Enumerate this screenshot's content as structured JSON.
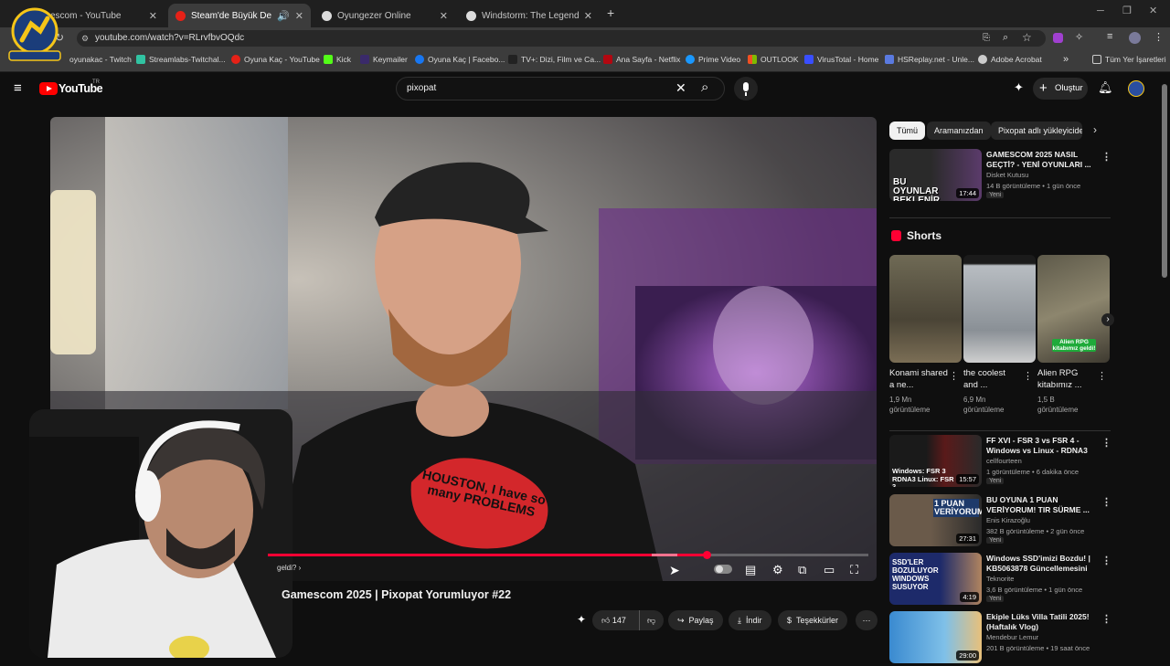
{
  "browser": {
    "tabs": [
      {
        "title": "escom - YouTube",
        "active": false
      },
      {
        "title": "Steam'de Büyük Değişiklik",
        "active": true
      },
      {
        "title": "Oyungezer Online",
        "active": false
      },
      {
        "title": "Windstorm: The Legend of Khi",
        "active": false
      }
    ],
    "url": "youtube.com/watch?v=RLrvfbvOQdc",
    "bookmarks": [
      "oyunakac - Twitch",
      "Streamlabs-Twitchal...",
      "Oyuna Kaç - YouTube",
      "Kick",
      "Keymailer",
      "Oyuna Kaç | Facebo...",
      "TV+: Dizi, Film ve Ca...",
      "Ana Sayfa - Netflix",
      "Prime Video",
      "OUTLOOK",
      "VirusTotal - Home",
      "HSReplay.net - Unle...",
      "Adobe Acrobat"
    ],
    "all_bookmarks": "Tüm Yer İşaretleri"
  },
  "youtube": {
    "logo": "YouTube",
    "country": "TR",
    "search_value": "pixopat",
    "create_label": "Oluştur"
  },
  "video": {
    "title": "Gamescom 2025 | Pixopat Yorumluyor #22",
    "chapter": "geldi?",
    "progress": 0.73,
    "likes": "147",
    "share": "Paylaş",
    "download": "İndir",
    "thanks": "Teşekkürler",
    "shirt_text": "HOUSTON, I have so many PROBLEMS"
  },
  "sidebar": {
    "chips": [
      "Tümü",
      "Aramanızdan",
      "Pixopat adlı yükleyiciden"
    ],
    "shorts_title": "Shorts",
    "shorts": [
      {
        "title": "Konami shared a ne...",
        "views": "1,9 Mn görüntüleme"
      },
      {
        "title": "the coolest and ...",
        "views": "6,9 Mn görüntüleme"
      },
      {
        "title": "Alien RPG kitabımız ...",
        "views": "1,5 B görüntüleme"
      }
    ],
    "recs": [
      {
        "title": "GAMESCOM 2025 NASIL GEÇTİ? - YENİ OYUNLARI ...",
        "channel": "Disket Kutusu",
        "meta": "14 B görüntüleme • 1 gün önce",
        "badge": "Yeni",
        "duration": "17:44"
      },
      {
        "title": "FF XVI - FSR 3 vs FSR 4 - Windows vs Linux - RDNA3 RX...",
        "channel": "cellfourteen",
        "meta": "1 görüntüleme • 6 dakika önce",
        "badge": "Yeni",
        "duration": "15:57"
      },
      {
        "title": "BU OYUNA 1 PUAN VERİYORUM! TIR SÜRME ...",
        "channel": "Enis Kirazoğlu",
        "meta": "382 B görüntüleme • 2 gün önce",
        "badge": "Yeni",
        "duration": "27:31"
      },
      {
        "title": "Windows SSD'imizi Bozdu! | KB5063878 Güncellemesini ...",
        "channel": "Teknorite",
        "meta": "3,6 B görüntüleme • 1 gün önce",
        "badge": "Yeni",
        "duration": "4:19"
      },
      {
        "title": "Ekiple Lüks Villa Tatili 2025! (Haftalık Vlog)",
        "channel": "Mendebur Lemur",
        "meta": "201 B görüntüleme • 19 saat önce",
        "badge": "",
        "duration": "29:00"
      }
    ],
    "thumb_text": [
      "BU OYUNLAR BEKLENİR",
      "Windows: FSR 3 RDNA3 Linux: FSR 3",
      "1 PUAN VERİYORUM",
      "SSD'LER BOZULUYOR WINDOWS SUSUYOR",
      "Alien RPG kitabımız geldi!"
    ]
  }
}
